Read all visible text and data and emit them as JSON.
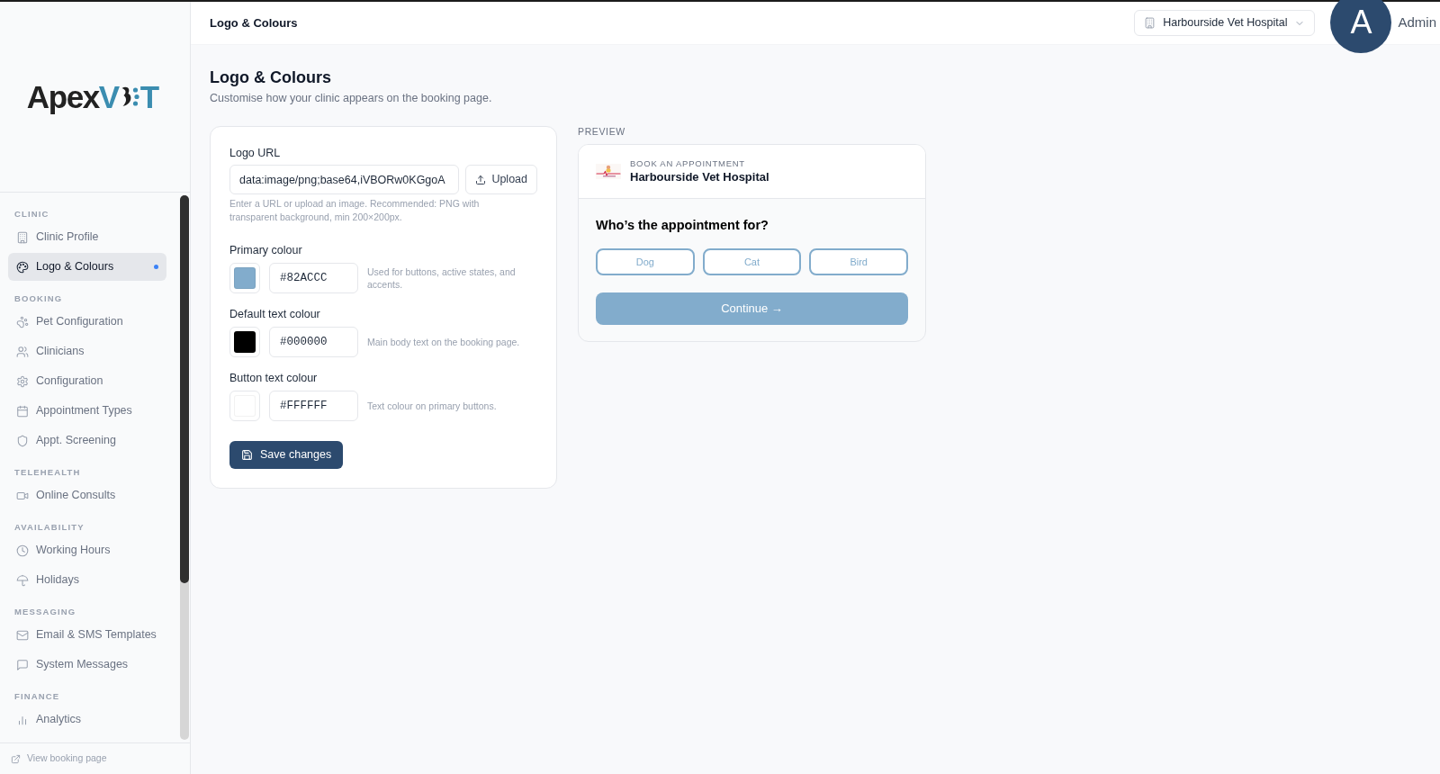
{
  "header": {
    "title": "Logo & Colours",
    "clinic_select": "Harbourside Vet Hospital",
    "user": {
      "initial": "A",
      "name": "Admin"
    }
  },
  "sidebar": {
    "logo": {
      "word": "Apex",
      "accent_start": "V",
      "accent_end": "T"
    },
    "sections": [
      {
        "label": "CLINIC",
        "items": [
          {
            "label": "Clinic Profile",
            "selected": false
          },
          {
            "label": "Logo & Colours",
            "selected": true
          }
        ]
      },
      {
        "label": "BOOKING",
        "items": [
          {
            "label": "Pet Configuration",
            "selected": false
          },
          {
            "label": "Clinicians",
            "selected": false
          },
          {
            "label": "Configuration",
            "selected": false
          },
          {
            "label": "Appointment Types",
            "selected": false
          },
          {
            "label": "Appt. Screening",
            "selected": false
          }
        ]
      },
      {
        "label": "TELEHEALTH",
        "items": [
          {
            "label": "Online Consults",
            "selected": false
          }
        ]
      },
      {
        "label": "AVAILABILITY",
        "items": [
          {
            "label": "Working Hours",
            "selected": false
          },
          {
            "label": "Holidays",
            "selected": false
          }
        ]
      },
      {
        "label": "MESSAGING",
        "items": [
          {
            "label": "Email & SMS Templates",
            "selected": false
          },
          {
            "label": "System Messages",
            "selected": false
          }
        ]
      },
      {
        "label": "FINANCE",
        "items": [
          {
            "label": "Analytics",
            "selected": false
          }
        ]
      }
    ],
    "footer_link": "View booking page"
  },
  "page": {
    "title": "Logo & Colours",
    "subtitle": "Customise how your clinic appears on the booking page."
  },
  "form": {
    "logo_url": {
      "label": "Logo URL",
      "value": "data:image/png;base64,iVBORw0KGgoA",
      "upload_button": "Upload",
      "hint": "Enter a URL or upload an image. Recommended: PNG with transparent background, min 200×200px."
    },
    "colours": [
      {
        "label": "Primary colour",
        "color": "#82accc",
        "value": "#82ACCC",
        "help": "Used for buttons, active states, and accents."
      },
      {
        "label": "Default text colour",
        "color": "#000000",
        "value": "#000000",
        "help": "Main body text on the booking page."
      },
      {
        "label": "Button text colour",
        "color": "#ffffff",
        "value": "#FFFFFF",
        "help": "Text colour on primary buttons."
      }
    ],
    "save_button": "Save changes"
  },
  "preview": {
    "label": "PREVIEW",
    "eyebrow": "BOOK AN APPOINTMENT",
    "clinic_name": "Harbourside Vet Hospital",
    "question": "Who’s the appointment for?",
    "pet_options": [
      {
        "label": "Dog",
        "selected": false
      },
      {
        "label": "Cat",
        "selected": false
      },
      {
        "label": "Bird",
        "selected": false
      }
    ],
    "continue_button": "Continue →"
  }
}
